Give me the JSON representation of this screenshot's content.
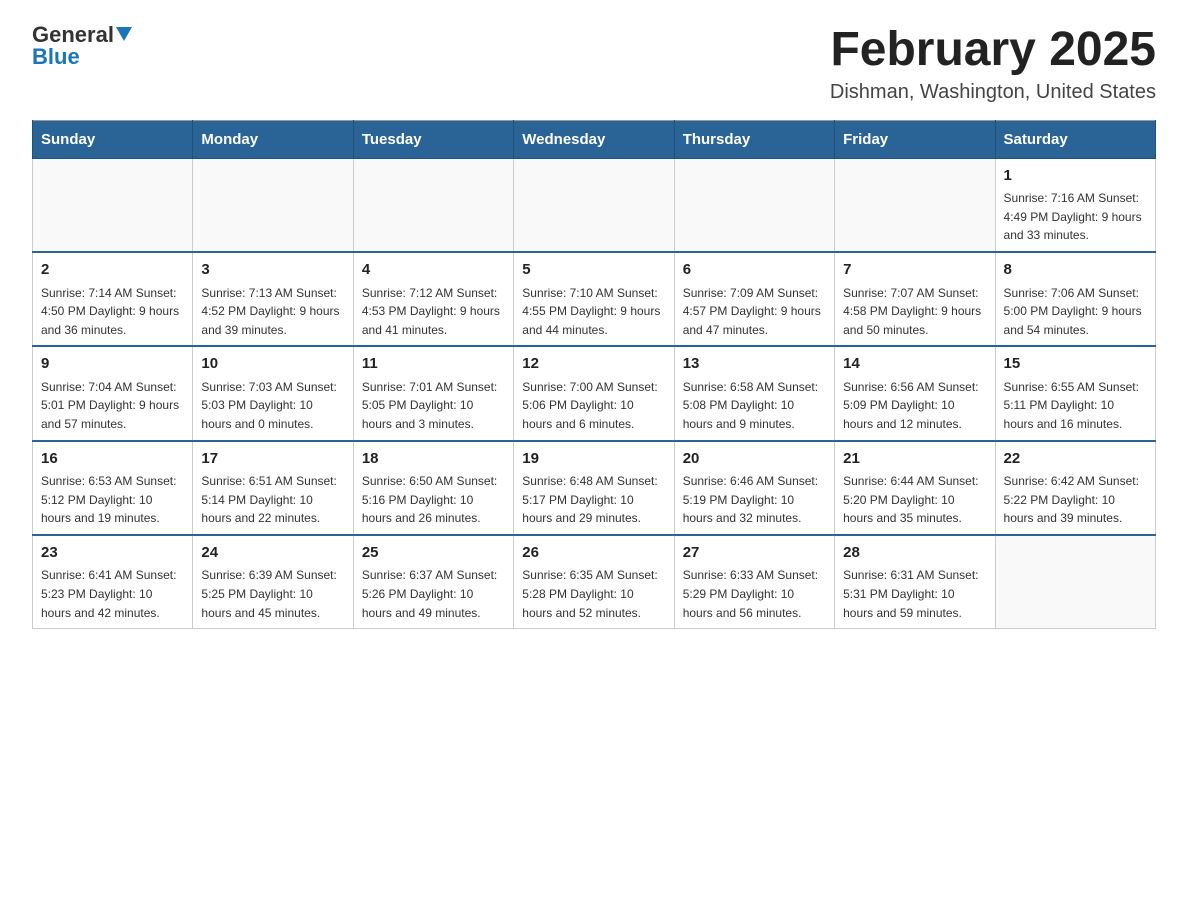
{
  "header": {
    "logo_general": "General",
    "logo_blue": "Blue",
    "month_title": "February 2025",
    "location": "Dishman, Washington, United States"
  },
  "days_of_week": [
    "Sunday",
    "Monday",
    "Tuesday",
    "Wednesday",
    "Thursday",
    "Friday",
    "Saturday"
  ],
  "weeks": [
    [
      {
        "day": "",
        "info": ""
      },
      {
        "day": "",
        "info": ""
      },
      {
        "day": "",
        "info": ""
      },
      {
        "day": "",
        "info": ""
      },
      {
        "day": "",
        "info": ""
      },
      {
        "day": "",
        "info": ""
      },
      {
        "day": "1",
        "info": "Sunrise: 7:16 AM\nSunset: 4:49 PM\nDaylight: 9 hours and 33 minutes."
      }
    ],
    [
      {
        "day": "2",
        "info": "Sunrise: 7:14 AM\nSunset: 4:50 PM\nDaylight: 9 hours and 36 minutes."
      },
      {
        "day": "3",
        "info": "Sunrise: 7:13 AM\nSunset: 4:52 PM\nDaylight: 9 hours and 39 minutes."
      },
      {
        "day": "4",
        "info": "Sunrise: 7:12 AM\nSunset: 4:53 PM\nDaylight: 9 hours and 41 minutes."
      },
      {
        "day": "5",
        "info": "Sunrise: 7:10 AM\nSunset: 4:55 PM\nDaylight: 9 hours and 44 minutes."
      },
      {
        "day": "6",
        "info": "Sunrise: 7:09 AM\nSunset: 4:57 PM\nDaylight: 9 hours and 47 minutes."
      },
      {
        "day": "7",
        "info": "Sunrise: 7:07 AM\nSunset: 4:58 PM\nDaylight: 9 hours and 50 minutes."
      },
      {
        "day": "8",
        "info": "Sunrise: 7:06 AM\nSunset: 5:00 PM\nDaylight: 9 hours and 54 minutes."
      }
    ],
    [
      {
        "day": "9",
        "info": "Sunrise: 7:04 AM\nSunset: 5:01 PM\nDaylight: 9 hours and 57 minutes."
      },
      {
        "day": "10",
        "info": "Sunrise: 7:03 AM\nSunset: 5:03 PM\nDaylight: 10 hours and 0 minutes."
      },
      {
        "day": "11",
        "info": "Sunrise: 7:01 AM\nSunset: 5:05 PM\nDaylight: 10 hours and 3 minutes."
      },
      {
        "day": "12",
        "info": "Sunrise: 7:00 AM\nSunset: 5:06 PM\nDaylight: 10 hours and 6 minutes."
      },
      {
        "day": "13",
        "info": "Sunrise: 6:58 AM\nSunset: 5:08 PM\nDaylight: 10 hours and 9 minutes."
      },
      {
        "day": "14",
        "info": "Sunrise: 6:56 AM\nSunset: 5:09 PM\nDaylight: 10 hours and 12 minutes."
      },
      {
        "day": "15",
        "info": "Sunrise: 6:55 AM\nSunset: 5:11 PM\nDaylight: 10 hours and 16 minutes."
      }
    ],
    [
      {
        "day": "16",
        "info": "Sunrise: 6:53 AM\nSunset: 5:12 PM\nDaylight: 10 hours and 19 minutes."
      },
      {
        "day": "17",
        "info": "Sunrise: 6:51 AM\nSunset: 5:14 PM\nDaylight: 10 hours and 22 minutes."
      },
      {
        "day": "18",
        "info": "Sunrise: 6:50 AM\nSunset: 5:16 PM\nDaylight: 10 hours and 26 minutes."
      },
      {
        "day": "19",
        "info": "Sunrise: 6:48 AM\nSunset: 5:17 PM\nDaylight: 10 hours and 29 minutes."
      },
      {
        "day": "20",
        "info": "Sunrise: 6:46 AM\nSunset: 5:19 PM\nDaylight: 10 hours and 32 minutes."
      },
      {
        "day": "21",
        "info": "Sunrise: 6:44 AM\nSunset: 5:20 PM\nDaylight: 10 hours and 35 minutes."
      },
      {
        "day": "22",
        "info": "Sunrise: 6:42 AM\nSunset: 5:22 PM\nDaylight: 10 hours and 39 minutes."
      }
    ],
    [
      {
        "day": "23",
        "info": "Sunrise: 6:41 AM\nSunset: 5:23 PM\nDaylight: 10 hours and 42 minutes."
      },
      {
        "day": "24",
        "info": "Sunrise: 6:39 AM\nSunset: 5:25 PM\nDaylight: 10 hours and 45 minutes."
      },
      {
        "day": "25",
        "info": "Sunrise: 6:37 AM\nSunset: 5:26 PM\nDaylight: 10 hours and 49 minutes."
      },
      {
        "day": "26",
        "info": "Sunrise: 6:35 AM\nSunset: 5:28 PM\nDaylight: 10 hours and 52 minutes."
      },
      {
        "day": "27",
        "info": "Sunrise: 6:33 AM\nSunset: 5:29 PM\nDaylight: 10 hours and 56 minutes."
      },
      {
        "day": "28",
        "info": "Sunrise: 6:31 AM\nSunset: 5:31 PM\nDaylight: 10 hours and 59 minutes."
      },
      {
        "day": "",
        "info": ""
      }
    ]
  ]
}
